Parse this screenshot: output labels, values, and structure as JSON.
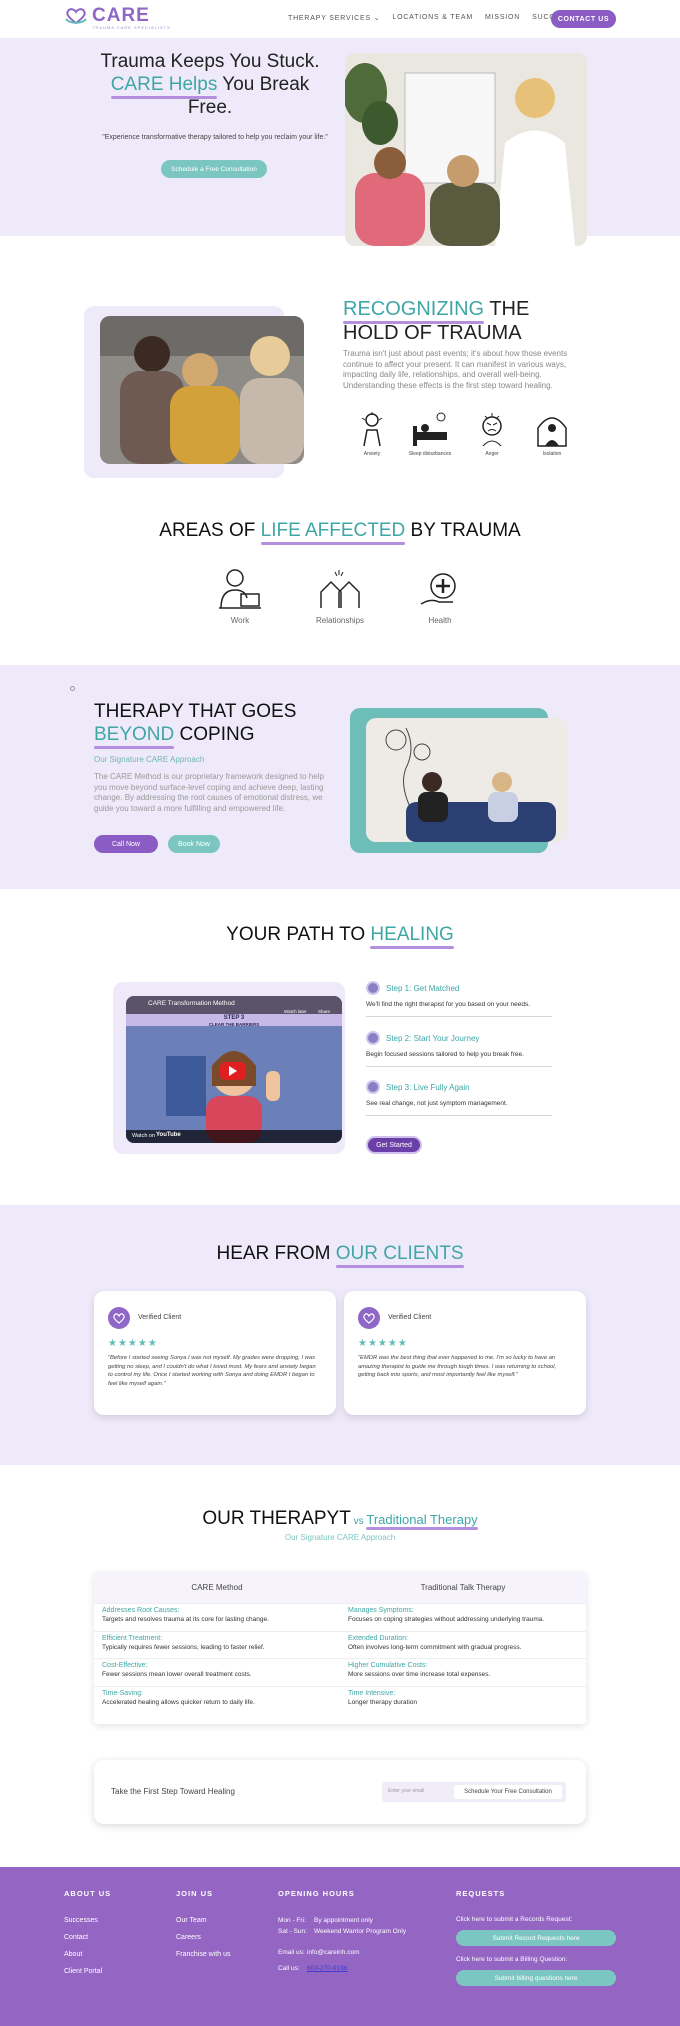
{
  "header": {
    "logo_text": "CARE",
    "logo_subtitle": "TRAUMA CARE SPECIALISTS",
    "nav": [
      "THERAPY SERVICES ⌄",
      "LOCATIONS & TEAM",
      "MISSION",
      "SUCCESS STORIES"
    ],
    "contact_label": "CONTACT US"
  },
  "hero": {
    "title_line1": "Trauma Keeps You Stuck.",
    "title_accent": "CARE Helps",
    "title_line2": " You Break",
    "title_line3": "Free.",
    "quote": "\"Experience transformative therapy tailored to help you reclaim your life.\"",
    "cta": "Schedule a Free Consultation"
  },
  "recognizing": {
    "title_accent": "RECOGNIZING",
    "title_rest1": " THE",
    "title_rest2": "HOLD OF TRAUMA",
    "text": "Trauma isn't just about past events; it's about how those events continue to affect your present. It can manifest in various ways, impacting daily life, relationships, and overall well-being. Understanding these effects is the first step toward healing.",
    "symptoms": [
      "Anxiety",
      "Sleep disturbances",
      "Anger",
      "Isolation"
    ]
  },
  "areas": {
    "title_pre": "AREAS OF ",
    "title_accent": "LIFE AFFECTED",
    "title_post": " BY TRAUMA",
    "items": [
      "Work",
      "Relationships",
      "Health"
    ]
  },
  "beyond": {
    "title_line1": "THERAPY THAT GOES",
    "title_accent": "BEYOND",
    "title_post": " COPING",
    "subtitle": "Our Signature CARE Approach",
    "text": "The CARE Method is our proprietary framework designed to help you move beyond surface-level coping and achieve deep, lasting change. By addressing the root causes of emotional distress, we guide you toward a more fulfilling and empowered life.",
    "call": "Call Now",
    "book": "Book Now"
  },
  "path": {
    "title_pre": "YOUR PATH TO ",
    "title_accent": "HEALING",
    "video": {
      "title": "CARE Transformation Method",
      "watch_later": "Watch later",
      "share": "Share",
      "step_label": "STEP 3",
      "step_sub": "CLEAR THE BARRIERS",
      "watch_on": "Watch on",
      "youtube": "YouTube"
    },
    "steps": [
      {
        "title": "Step 1: Get Matched",
        "desc": "We'll find the right therapist for you based on your needs."
      },
      {
        "title": "Step 2: Start Your Journey",
        "desc": "Begin focused sessions tailored to help you break free."
      },
      {
        "title": "Step 3: Live Fully Again",
        "desc": "See real change, not just symptom management."
      }
    ],
    "cta": "Get Started"
  },
  "clients": {
    "title_pre": "HEAR FROM ",
    "title_accent": "OUR CLIENTS",
    "reviews": [
      {
        "label": "Verified Client",
        "stars": "★★★★★",
        "quote": "\"Before I started seeing Sonya I was not myself. My grades were dropping, I was getting no sleep, and I couldn't do what I loved most. My fears and anxiety began to control my life. Once I started working with Sonya and doing EMDR I began to feel like myself again.\""
      },
      {
        "label": "Verified Client",
        "stars": "★★★★★",
        "quote": "\"EMDR was the best thing that ever happened to me. I'm so lucky to have an amazing therapist to guide me through tough times. I was returning to school, getting back into sports, and most importantly feel like myself.\""
      }
    ]
  },
  "compare": {
    "title_pre": "OUR THERAPYT",
    "title_vs": " vs ",
    "title_accent": "Traditional Therapy",
    "subtitle": "Our Signature CARE Approach",
    "col1": "CARE Method",
    "col2": "Traditional Talk Therapy",
    "rows": [
      {
        "a_t": "Addresses Root Causes:",
        "a_d": "Targets and resolves trauma at its core for lasting change.",
        "b_t": "Manages Symptoms:",
        "b_d": "Focuses on coping strategies without addressing underlying trauma."
      },
      {
        "a_t": "Efficient Treatment:",
        "a_d": "Typically requires fewer sessions, leading to faster relief.",
        "b_t": "Extended Duration:",
        "b_d": "Often involves long-term commitment with gradual progress."
      },
      {
        "a_t": "Cost-Effective:",
        "a_d": "Fewer sessions mean lower overall treatment costs.",
        "b_t": "Higher Cumulative Costs:",
        "b_d": "More sessions over time increase total expenses."
      },
      {
        "a_t": "Time-Saving:",
        "a_d": "Accelerated healing allows quicker return to daily life.",
        "b_t": "Time Intensive:",
        "b_d": "Longer therapy duration"
      }
    ]
  },
  "first_step": {
    "text": "Take the First Step Toward Healing",
    "placeholder": "Enter your email",
    "button": "Schedule Your Free Consultation"
  },
  "footer": {
    "about_h": "ABOUT US",
    "about": [
      "Successes",
      "Contact",
      "About",
      "Client Portal"
    ],
    "join_h": "JOIN US",
    "join": [
      "Our Team",
      "Careers",
      "Franchise with us"
    ],
    "hours_h": "OPENING HOURS",
    "hours": [
      {
        "day": "Mon - Fri:",
        "val": "By appointment only"
      },
      {
        "day": "Sat - Sun:",
        "val": "Weekend Warrior Program Only"
      }
    ],
    "email_label": "Email us:",
    "email": "info@careinh.com",
    "call_label": "Call us:",
    "phone": "603-270-9196",
    "requests_h": "REQUESTS",
    "records_text": "Click here to submit a Records Request:",
    "records_btn": "Submit Record Requests here",
    "billing_text": "Click here to submit a Billing Question:",
    "billing_btn": "Submit billing questions here"
  },
  "colors": {
    "purple": "#8a5cc4",
    "teal": "#3fa6a6",
    "lavender_bg": "#efeafa",
    "footer": "#9465c2"
  }
}
